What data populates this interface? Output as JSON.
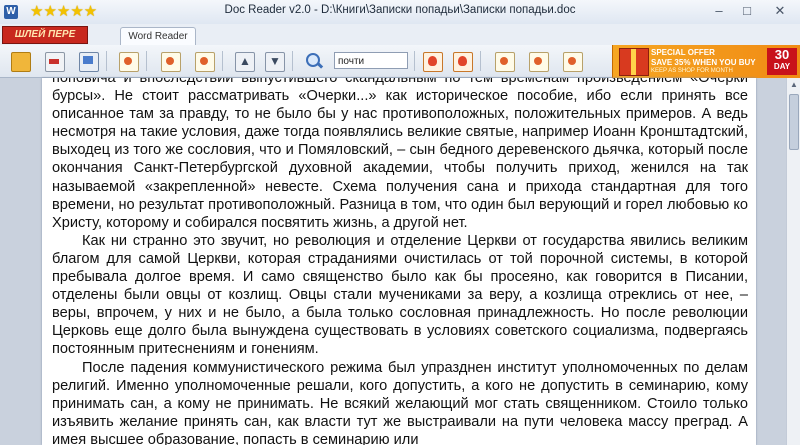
{
  "window": {
    "title": "Doc Reader v2.0 - D:\\Книги\\Записки попадьи\\Записки попадьи.doc",
    "app_icon": "W",
    "rating_stars": "★★★★★",
    "rating": 5,
    "minimize": "–",
    "maximize": "□",
    "close": "✕"
  },
  "tabs": {
    "logo_text": "ШЛЕЙ ПЕРЕ",
    "active_tab": "Word Reader"
  },
  "toolbar": {
    "search_value": "почти",
    "icons": [
      "folder-open-icon",
      "print-icon",
      "screen-icon",
      "document-icon",
      "document-icon",
      "arrow-up-icon",
      "arrow-down-icon",
      "zoom-icon",
      "fire-icon",
      "fire-icon",
      "document-icon",
      "document-icon",
      "document-icon"
    ]
  },
  "ad": {
    "line1": "SPECIAL OFFER",
    "line2": "SAVE 35% WHEN YOU BUY",
    "line3": "KEEP AS SHOP FOR MONTH",
    "badge_number": "30",
    "badge_label": "DAY"
  },
  "document": {
    "paragraphs": [
      "поповича и впоследствии выпустившего скандальным по тем временам произведением «Очерки бурсы». Не стоит рассматривать «Очерки...» как историческое пособие, ибо если принять все описанное там за правду, то не было бы у нас противоположных, положительных примеров. А ведь несмотря на такие условия, даже тогда появлялись великие святые, например Иоанн Кронштадтский, выходец из того же сословия, что и Помяловский, – сын бедного деревенского дьячка, который после окончания Санкт-Петербургской духовной академии, чтобы получить приход, женился на так называемой «закрепленной» невесте. Схема получения сана и прихода стандартная для того времени, но результат противоположный. Разница в том, что один был верующий и горел любовью ко Христу, которому и собирался посвятить жизнь, а другой нет.",
      "Как ни странно это звучит, но революция и отделение Церкви от государства явились великим благом для самой Церкви, которая страданиями очистилась от той порочной системы, в которой пребывала долгое время. И само священство было как бы просеяно, как говорится в Писании, отделены были овцы от козлищ. Овцы стали мучениками за веру, а козлища отреклись от нее, – веры, впрочем, у них и не было, а была только сословная принадлежность. Но после революции Церковь еще долго была вынуждена существовать в условиях советского социализма, подвергаясь постоянным притеснениям и гонениям.",
      "После падения коммунистического режима был упразднен институт уполномоченных по делам религий. Именно уполномоченные решали, кого допустить, а кого не допустить в семинарию, кому принимать сан, а кому не принимать. Не всякий желающий мог стать священником. Стоило только изъявить желание принять сан, как власти тут же выстраивали на пути человека массу преград. А имея высшее образование, попасть в семинарию или"
    ]
  },
  "scrollbar": {
    "up_arrow": "▲"
  }
}
